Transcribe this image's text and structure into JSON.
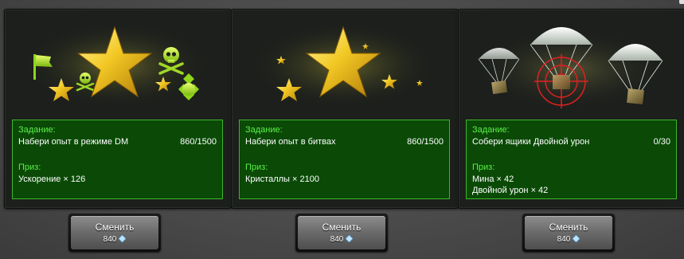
{
  "cards": [
    {
      "task_label": "Задание:",
      "task_text": "Набери опыт в режиме DM",
      "task_progress": "860/1500",
      "prize_label": "Приз:",
      "prize_lines": [
        "Ускорение × 126"
      ],
      "button": {
        "label": "Сменить",
        "price": "840"
      },
      "art_icons": [
        "star-icon",
        "flag-icon",
        "skull-icon",
        "target-icon"
      ]
    },
    {
      "task_label": "Задание:",
      "task_text": "Набери опыт в битвах",
      "task_progress": "860/1500",
      "prize_label": "Приз:",
      "prize_lines": [
        "Кристаллы × 2100"
      ],
      "button": {
        "label": "Сменить",
        "price": "840"
      },
      "art_icons": [
        "star-icon"
      ]
    },
    {
      "task_label": "Задание:",
      "task_text": "Собери ящики Двойной урон",
      "task_progress": "0/30",
      "prize_label": "Приз:",
      "prize_lines": [
        "Мина × 42",
        "Двойной урон × 42"
      ],
      "button": {
        "label": "Сменить",
        "price": "840"
      },
      "art_icons": [
        "parachute-icon",
        "crosshair-icon",
        "supply-box-icon"
      ]
    }
  ],
  "colors": {
    "label_green": "#5cf04a",
    "panel_green": "#0a4a06",
    "panel_border": "#3fb52c",
    "card_bg": "#1c1f1c"
  },
  "currency_icon": "crystal-icon"
}
